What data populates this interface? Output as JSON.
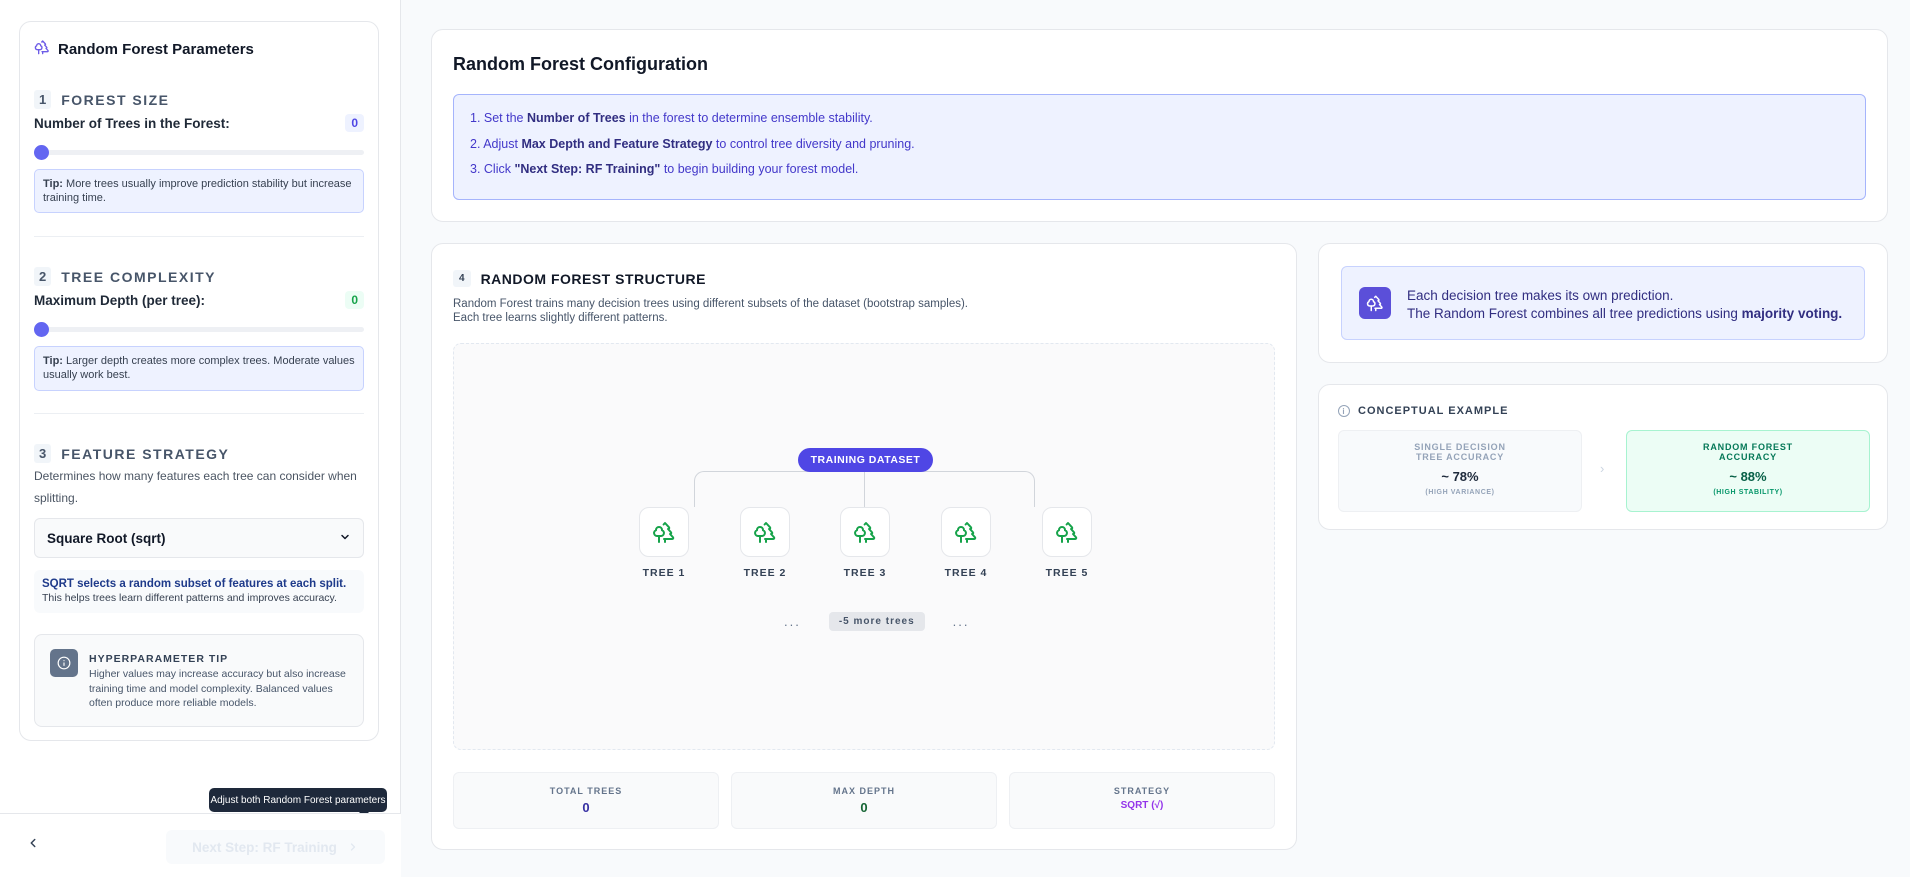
{
  "sidebar": {
    "title": "Random Forest Parameters",
    "icon": "trees-icon",
    "sections": {
      "forest_size": {
        "number": "1",
        "title": "FOREST SIZE",
        "label": "Number of Trees in the Forest:",
        "value": "0",
        "tip_bold": "Tip:",
        "tip_text": " More trees usually improve prediction stability but increase training time."
      },
      "tree_complexity": {
        "number": "2",
        "title": "TREE COMPLEXITY",
        "label": "Maximum Depth (per tree):",
        "value": "0",
        "tip_bold": "Tip:",
        "tip_text": " Larger depth creates more complex trees. Moderate values usually work best."
      },
      "feature_strategy": {
        "number": "3",
        "title": "FEATURE STRATEGY",
        "description": "Determines how many features each tree can consider when splitting.",
        "selected": "Square Root (sqrt)",
        "info_title": "SQRT selects a random subset of features at each split.",
        "info_text": "This helps trees learn different patterns and improves accuracy."
      }
    },
    "hyperparameter_tip": {
      "title": "HYPERPARAMETER TIP",
      "text": "Higher values may increase accuracy but also increase training time and model complexity. Balanced values often produce more reliable models."
    }
  },
  "footer": {
    "back_icon": "chevron-left-icon",
    "next_label": "Next Step: RF Training",
    "next_icon": "chevron-right-icon",
    "tooltip": "Adjust both Random Forest parameters"
  },
  "config": {
    "title": "Random Forest Configuration",
    "steps": [
      {
        "pre": "1.  Set the ",
        "bold": "Number of Trees",
        "post": " in the forest to determine ensemble stability."
      },
      {
        "pre": "2.  Adjust ",
        "bold": "Max Depth and Feature Strategy",
        "post": " to control tree diversity and pruning."
      },
      {
        "pre": "3.  Click ",
        "bold": "\"Next Step: RF Training\"",
        "post": " to begin building your forest model."
      }
    ]
  },
  "structure": {
    "number": "4",
    "title": "RANDOM FOREST STRUCTURE",
    "desc_line1": "Random Forest trains many decision trees using different subsets of the dataset (bootstrap samples).",
    "desc_line2": "Each tree learns slightly different patterns.",
    "dataset_label": "TRAINING DATASET",
    "trees": [
      "TREE 1",
      "TREE 2",
      "TREE 3",
      "TREE 4",
      "TREE 5"
    ],
    "dots": "...",
    "more_label": "-5 more trees",
    "stats": [
      {
        "label": "TOTAL TREES",
        "value": "0",
        "color": "#3730a3"
      },
      {
        "label": "MAX DEPTH",
        "value": "0",
        "color": "#166534"
      },
      {
        "label": "STRATEGY",
        "value": "SQRT (√)",
        "color": "#9333ea"
      }
    ]
  },
  "voting": {
    "line1": "Each decision tree makes its own prediction.",
    "line2_pre": "The Random Forest combines all tree predictions using ",
    "line2_bold": "majority voting."
  },
  "concept": {
    "title": "CONCEPTUAL EXAMPLE",
    "single": {
      "label": "SINGLE DECISION TREE ACCURACY",
      "value": "~ 78%",
      "sub": "(HIGH VARIANCE)"
    },
    "forest": {
      "label": "RANDOM FOREST ACCURACY",
      "value": "~ 88%",
      "sub": "(HIGH STABILITY)"
    },
    "arrow": "›"
  },
  "colors": {
    "accent": "#4f46e5",
    "tree_green": "#16a34a",
    "forest_green": "#065f46"
  }
}
